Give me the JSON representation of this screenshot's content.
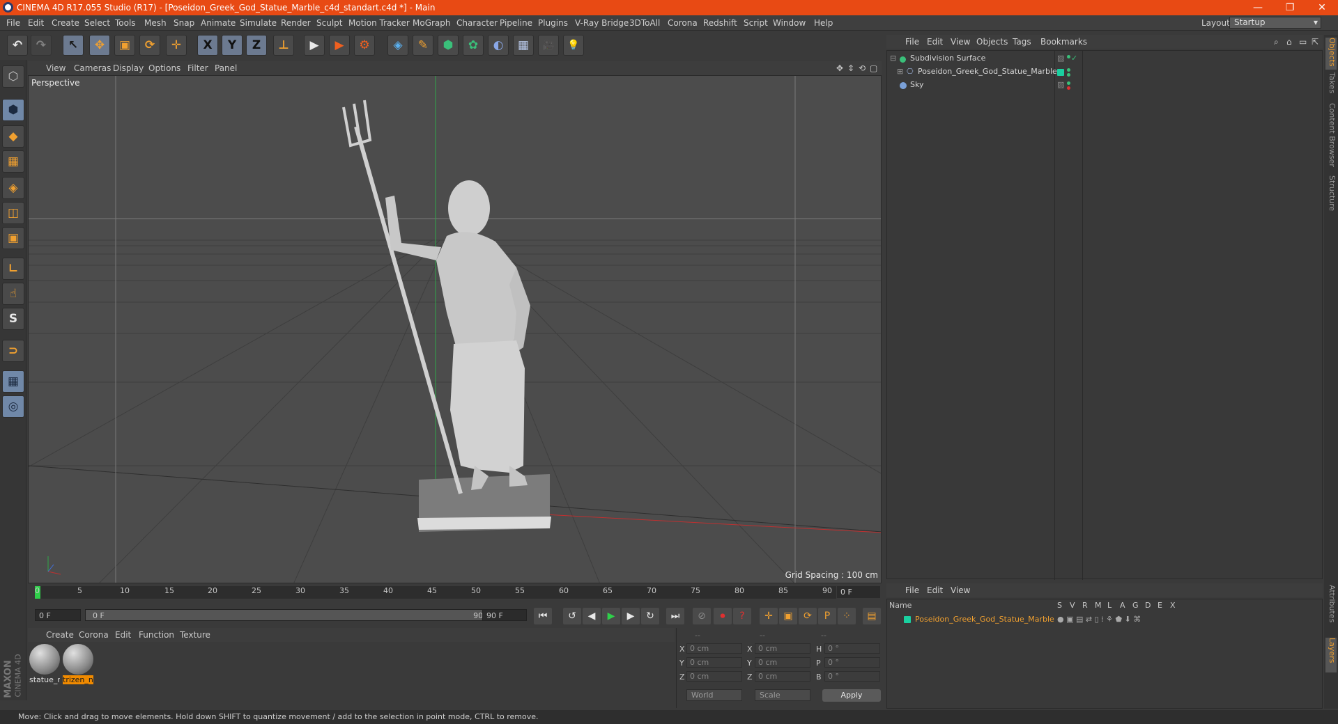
{
  "window": {
    "title": "CINEMA 4D R17.055 Studio (R17) - [Poseidon_Greek_God_Statue_Marble_c4d_standart.c4d *] - Main",
    "minimize": "—",
    "restore": "❐",
    "close": "✕"
  },
  "menu": [
    "File",
    "Edit",
    "Create",
    "Select",
    "Tools",
    "Mesh",
    "Snap",
    "Animate",
    "Simulate",
    "Render",
    "Sculpt",
    "Motion Tracker",
    "MoGraph",
    "Character",
    "Pipeline",
    "Plugins",
    "V-Ray Bridge",
    "3DToAll",
    "Corona",
    "Redshift",
    "Script",
    "Window",
    "Help"
  ],
  "layout": {
    "label": "Layout:",
    "value": "Startup"
  },
  "toolbar": {
    "undo": "↶",
    "redo": "↷",
    "select": "↖",
    "move": "✥",
    "scale": "▣",
    "rotate": "⟳",
    "transform": "✛",
    "x_axis": "X",
    "y_axis": "Y",
    "z_axis": "Z",
    "coord_system": "⊥",
    "render_view": "▶",
    "render_picture": "▶",
    "render_settings": "⚙",
    "cube": "◈",
    "pen": "✎",
    "subdivision": "⬢",
    "cloner": "✿",
    "deformer": "◐",
    "floor": "▦",
    "camera": "🎥",
    "light": "💡"
  },
  "lefttools": [
    "⬡",
    "⬢",
    "◆",
    "▦",
    "◈",
    "◫",
    "▣",
    "∟",
    "☝",
    "S",
    "⊃",
    "▦",
    "◎"
  ],
  "viewport": {
    "menu": [
      "View",
      "Cameras",
      "Display",
      "Options",
      "Filter",
      "Panel"
    ],
    "label": "Perspective",
    "grid_spacing": "Grid Spacing : 100 cm",
    "nav_icons": [
      "✥",
      "⇕",
      "⟲",
      "▢"
    ]
  },
  "timeline": {
    "ticks": [
      "0",
      "5",
      "10",
      "15",
      "20",
      "25",
      "30",
      "35",
      "40",
      "45",
      "50",
      "55",
      "60",
      "65",
      "70",
      "75",
      "80",
      "85",
      "90"
    ],
    "current_frame": "0 F",
    "start": "0 F",
    "range_start": "0 F",
    "range_end": "90 F",
    "end": "90 F",
    "playback_fraction": 0
  },
  "transport": {
    "first": "⏮",
    "prev_key": "↺",
    "prev_frame": "◀",
    "play": "▶",
    "next_frame": "▶",
    "next_key": "↻",
    "last": "⏭",
    "rec_off": "⊘",
    "record": "⏺",
    "auto_key": "?",
    "move_key": "✛",
    "scale_key": "▣",
    "rot_key": "⟳",
    "param_key": "P",
    "point_key": "⁘",
    "timeline_btn": "▤"
  },
  "materials": {
    "menu": [
      "Create",
      "Corona",
      "Edit",
      "Function",
      "Texture"
    ],
    "items": [
      {
        "name": "statue_r",
        "selected": false
      },
      {
        "name": "trizen_n",
        "selected": true
      }
    ]
  },
  "brand": {
    "maxon": "MAXON",
    "product": "CINEMA 4D"
  },
  "coords": {
    "headers": [
      "--",
      "--",
      "--"
    ],
    "rows": [
      {
        "a": "X",
        "av": "0 cm",
        "b": "X",
        "bv": "0 cm",
        "c": "H",
        "cv": "0 °"
      },
      {
        "a": "Y",
        "av": "0 cm",
        "b": "Y",
        "bv": "0 cm",
        "c": "P",
        "cv": "0 °"
      },
      {
        "a": "Z",
        "av": "0 cm",
        "b": "Z",
        "bv": "0 cm",
        "c": "B",
        "cv": "0 °"
      }
    ],
    "space": "World",
    "mode": "Scale",
    "apply": "Apply"
  },
  "status": "Move: Click and drag to move elements. Hold down SHIFT to quantize movement / add to the selection in point mode, CTRL to remove.",
  "objects": {
    "menu": [
      "File",
      "Edit",
      "View",
      "Objects",
      "Tags",
      "Bookmarks"
    ],
    "tree": [
      {
        "name": "Subdivision Surface",
        "expand": "⊟",
        "icon_color": "#3ac07a"
      },
      {
        "name": "Poseidon_Greek_God_Statue_Marble",
        "expand": "⊞",
        "icon_color": "#9ab0d8"
      },
      {
        "name": "Sky",
        "expand": "",
        "icon_color": "#7aa0d8"
      }
    ],
    "tag_color": "#1ad0a0"
  },
  "layers": {
    "menu": [
      "File",
      "Edit",
      "View"
    ],
    "headers": [
      "Name",
      "S",
      "V",
      "R",
      "M",
      "L",
      "A",
      "G",
      "D",
      "E",
      "X"
    ],
    "rows": [
      {
        "name": "Poseidon_Greek_God_Statue_Marble",
        "color": "#1ad0a0"
      }
    ]
  },
  "sidetabs": [
    "Objects",
    "Takes",
    "Content Browser",
    "Structure",
    "Attributes",
    "Layers"
  ]
}
